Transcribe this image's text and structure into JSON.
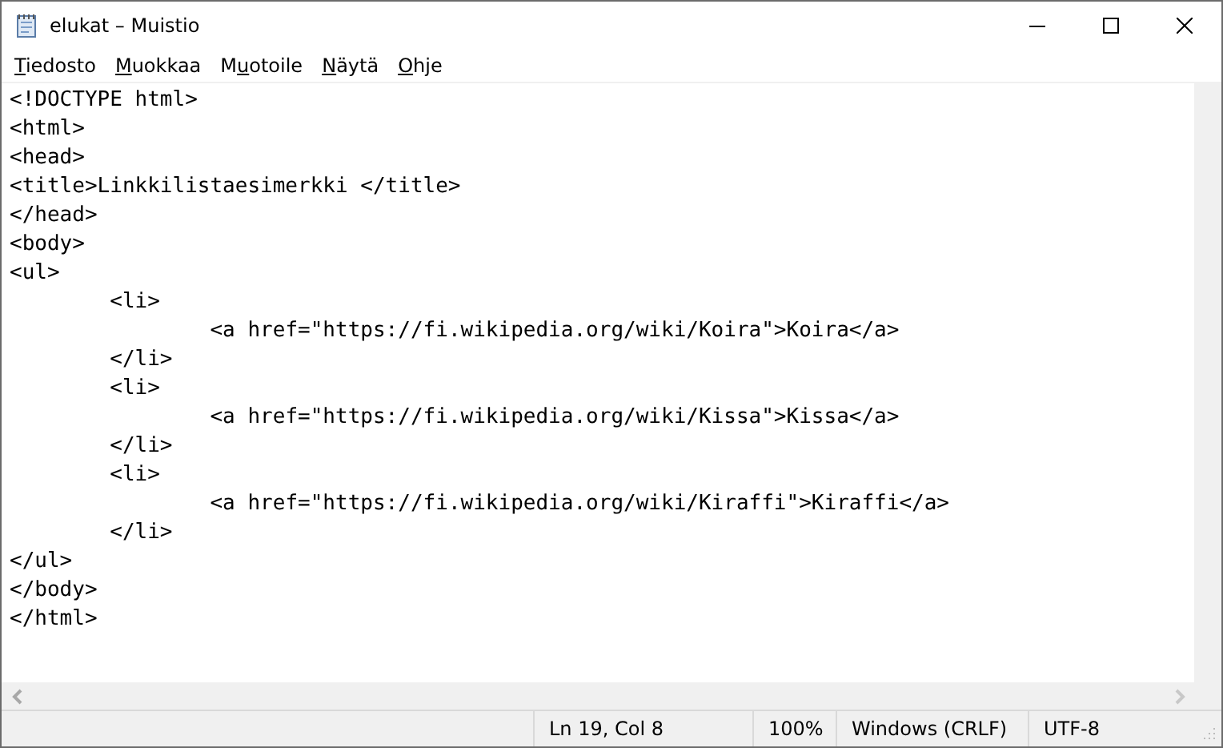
{
  "window": {
    "title": "elukat – Muistio"
  },
  "menu": [
    {
      "key": "T",
      "rest": "iedosto"
    },
    {
      "key": "M",
      "rest": "uokkaa"
    },
    {
      "pre": "M",
      "key": "u",
      "rest": "otoile"
    },
    {
      "key": "N",
      "rest": "äytä"
    },
    {
      "key": "O",
      "rest": "hje"
    }
  ],
  "editor": {
    "lines": [
      "<!DOCTYPE html>",
      "<html>",
      "<head>",
      "<title>Linkkilistaesimerkki </title>",
      "</head>",
      "<body>",
      "<ul>",
      "\t<li>",
      "\t\t<a href=\"https://fi.wikipedia.org/wiki/Koira\">Koira</a>",
      "\t</li>",
      "\t<li>",
      "\t\t<a href=\"https://fi.wikipedia.org/wiki/Kissa\">Kissa</a>",
      "\t</li>",
      "\t<li>",
      "\t\t<a href=\"https://fi.wikipedia.org/wiki/Kiraffi\">Kiraffi</a>",
      "\t</li>",
      "</ul>",
      "</body>",
      "</html>"
    ]
  },
  "status_bar": {
    "position": "Ln 19, Col 8",
    "zoom": "100%",
    "line_endings": "Windows (CRLF)",
    "encoding": "UTF-8"
  }
}
